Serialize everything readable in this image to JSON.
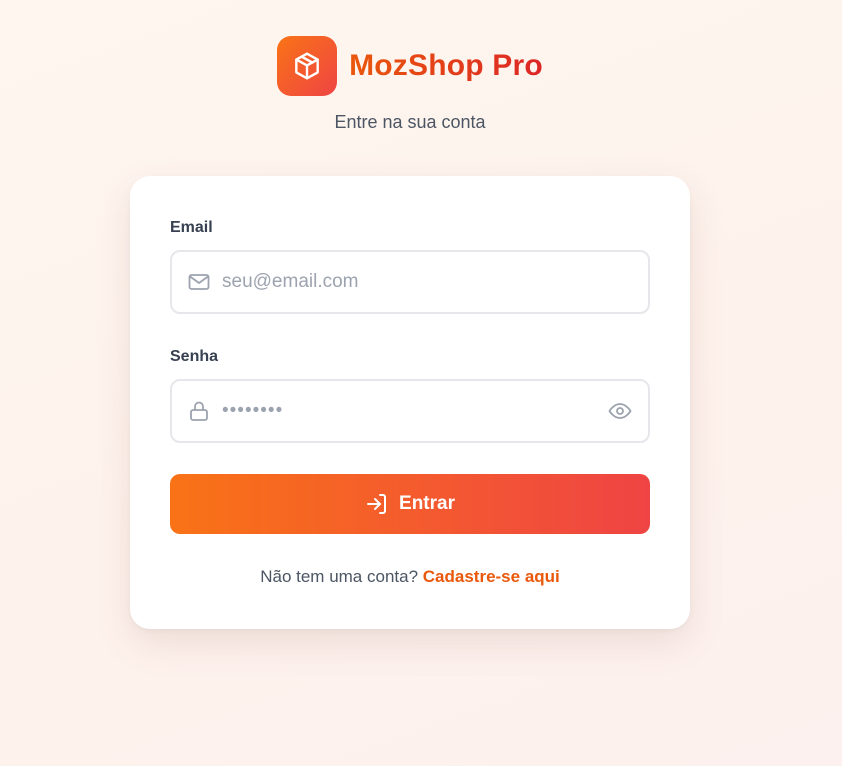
{
  "brand": {
    "name": "MozShop Pro",
    "logo_icon": "package-icon"
  },
  "subtitle": "Entre na sua conta",
  "form": {
    "email": {
      "label": "Email",
      "placeholder": "seu@email.com",
      "value": "",
      "icon": "mail-icon"
    },
    "password": {
      "label": "Senha",
      "value": "••••••••",
      "icon": "lock-icon",
      "toggle_icon": "eye-icon"
    },
    "submit": {
      "label": "Entrar",
      "icon": "login-icon"
    },
    "signup": {
      "prompt": "Não tem uma conta?",
      "link_label": "Cadastre-se aqui"
    }
  },
  "colors": {
    "accent_start": "#f97316",
    "accent_end": "#ef4444",
    "link": "#ea580c"
  }
}
